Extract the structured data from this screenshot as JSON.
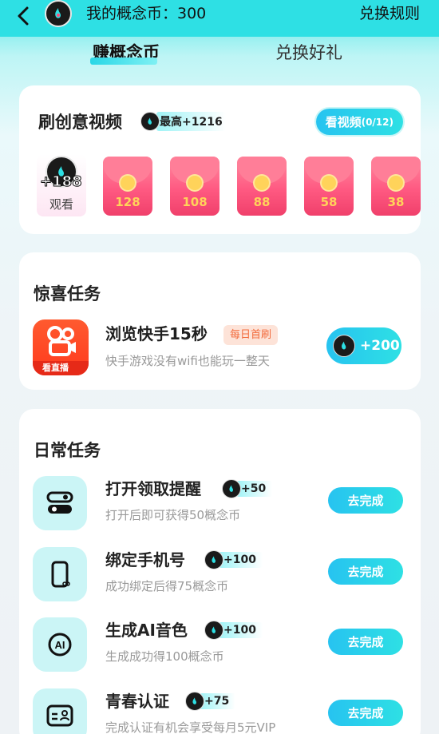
{
  "header": {
    "title": "我的概念币：300",
    "rules_link": "兑换规则"
  },
  "tabs": [
    {
      "label": "赚概念币",
      "active": true
    },
    {
      "label": "兑换好礼",
      "active": false
    }
  ],
  "video_section": {
    "title": "刷创意视频",
    "max_prefix": "最高",
    "max_amount": "+1216",
    "watch_button": "看视频",
    "watch_progress": "(0/12)",
    "first_reward": {
      "amount": "+188",
      "label": "观看"
    },
    "envelopes": [
      "128",
      "108",
      "88",
      "58",
      "38"
    ]
  },
  "surprise_section": {
    "title": "惊喜任务",
    "task": {
      "title": "浏览快手15秒",
      "tag": "每日首刷",
      "description": "快手游戏没有wifi也能玩一整天",
      "reward": "+200",
      "app_banner": "看直播"
    }
  },
  "daily_section": {
    "title": "日常任务",
    "tasks": [
      {
        "title": "打开领取提醒",
        "points": "+50",
        "description": "打开后即可获得50概念币",
        "button": "去完成",
        "icon": "toggle-icon"
      },
      {
        "title": "绑定手机号",
        "points": "+100",
        "description": "成功绑定后得75概念币",
        "button": "去完成",
        "icon": "phone-icon"
      },
      {
        "title": "生成AI音色",
        "points": "+100",
        "description": "生成成功得100概念币",
        "button": "去完成",
        "icon": "ai-voice-icon"
      },
      {
        "title": "青春认证",
        "points": "+75",
        "description": "完成认证有机会享受每月5元VIP",
        "button": "去完成",
        "icon": "id-card-icon"
      }
    ]
  },
  "colors": {
    "accent": "#2ee0e4",
    "button_gradient_start": "#27c3f0",
    "envelope_red": "#ff5a82",
    "tag_orange": "#f26b3c"
  }
}
